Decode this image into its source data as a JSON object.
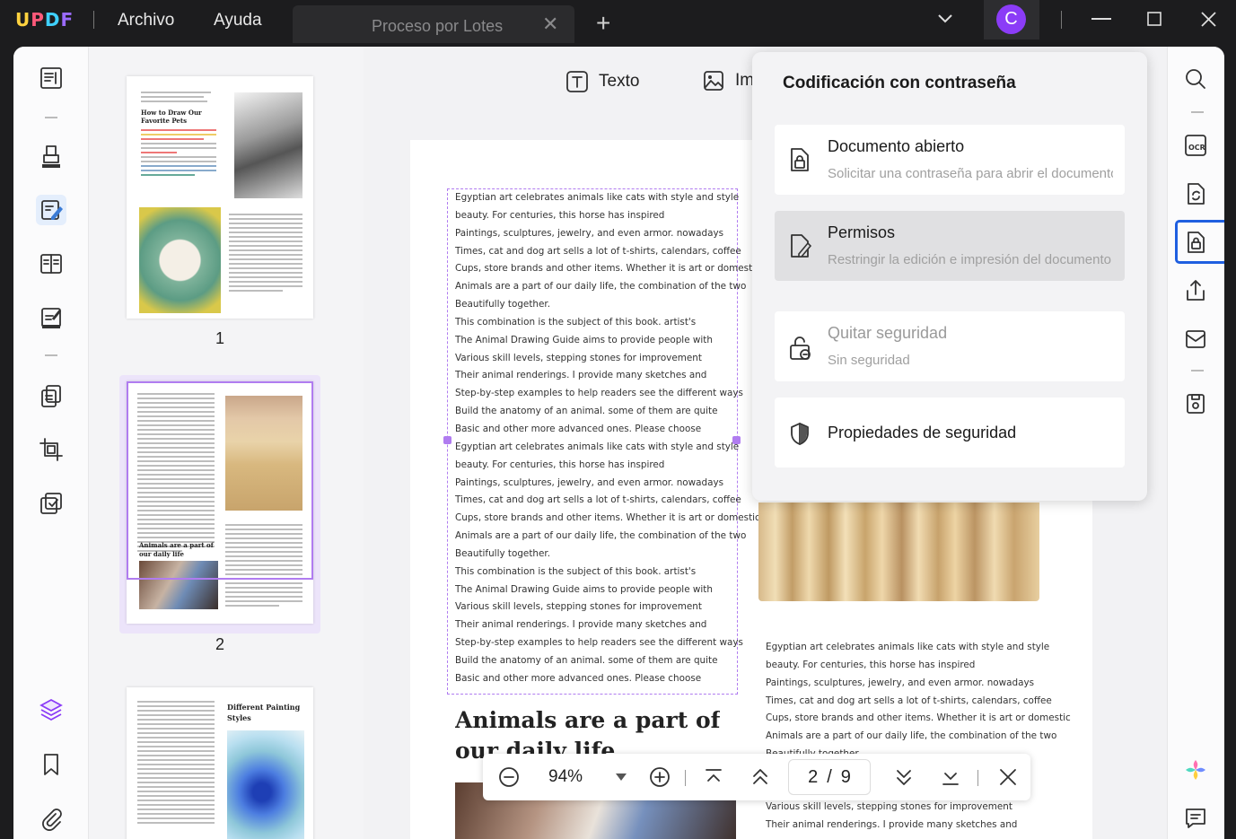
{
  "app": {
    "logo": "UPDF"
  },
  "menu": {
    "archivo": "Archivo",
    "ayuda": "Ayuda"
  },
  "tab": {
    "title": "Proceso por Lotes",
    "close": "✕",
    "new": "+"
  },
  "user": {
    "initial": "C"
  },
  "toolbar": {
    "texto": "Texto",
    "imagen": "Im"
  },
  "thumbnails": {
    "p1": "1",
    "p2": "2",
    "t1a": "How to Draw Our",
    "t1b": "Favorite Pets",
    "t2a": "Animals are a part of",
    "t2b": "our daily life",
    "t3a": "Different Painting",
    "t3b": "Styles"
  },
  "doc": {
    "lines": [
      "Egyptian art celebrates animals like cats with style and style",
      "beauty. For centuries, this horse has inspired",
      "Paintings, sculptures, jewelry, and even armor. nowadays",
      "Times, cat and dog art sells a lot of t-shirts, calendars, coffee",
      "Cups, store brands and other items. Whether it is art or domestic",
      "Animals are a part of our daily life, the combination of the two",
      "Beautifully together.",
      "This combination is the subject of this book. artist's",
      "The Animal Drawing Guide aims to provide people with",
      "Various skill levels, stepping stones for improvement",
      "Their animal renderings. I provide many sketches and",
      "Step-by-step examples to help readers see the different ways",
      "Build the anatomy of an animal. some of them are quite",
      "Basic and other more advanced ones. Please choose",
      "Egyptian art celebrates animals like cats with style and style",
      "beauty. For centuries, this horse has inspired",
      "Paintings, sculptures, jewelry, and even armor. nowadays",
      "Times, cat and dog art sells a lot of t-shirts, calendars, coffee",
      "Cups, store brands and other items. Whether it is art or domestic",
      "Animals are a part of our daily life, the combination of the two",
      "Beautifully together.",
      "This combination is the subject of this book. artist's",
      "The Animal Drawing Guide aims to provide people with",
      "Various skill levels, stepping stones for improvement",
      "Their animal renderings. I provide many sketches and",
      "Step-by-step examples to help readers see the different ways",
      "Build the anatomy of an animal. some of them are quite",
      "Basic and other more advanced ones. Please choose"
    ],
    "heading1": "Animals are a part of",
    "heading2": "our daily life",
    "right_lines": [
      "Egyptian art celebrates animals like cats with style and style",
      "beauty. For centuries, this horse has inspired",
      "Paintings, sculptures, jewelry, and even armor. nowadays",
      "Times, cat and dog art sells a lot of t-shirts, calendars, coffee",
      "Cups, store brands and other items. Whether it is art or domestic",
      "Animals are a part of our daily life, the combination of the two",
      "Beautifully together."
    ],
    "right_lines_bottom": [
      "Various skill levels, stepping stones for improvement",
      "Their animal renderings. I provide many sketches and"
    ]
  },
  "popup": {
    "title": "Codificación con contraseña",
    "options": [
      {
        "title": "Documento abierto",
        "subtitle": "Solicitar una contraseña para abrir el documento"
      },
      {
        "title": "Permisos",
        "subtitle": "Restringir la edición e impresión del documento"
      },
      {
        "title": "Quitar seguridad",
        "subtitle": "Sin seguridad"
      },
      {
        "title": "Propiedades de seguridad",
        "subtitle": ""
      }
    ]
  },
  "zoom": {
    "value": "94%",
    "page": "2",
    "sep": "/",
    "total": "9"
  },
  "colors": {
    "accent": "#8b3cf7",
    "highlight_border": "#1f5fe0",
    "selection": "#b07cf0"
  }
}
